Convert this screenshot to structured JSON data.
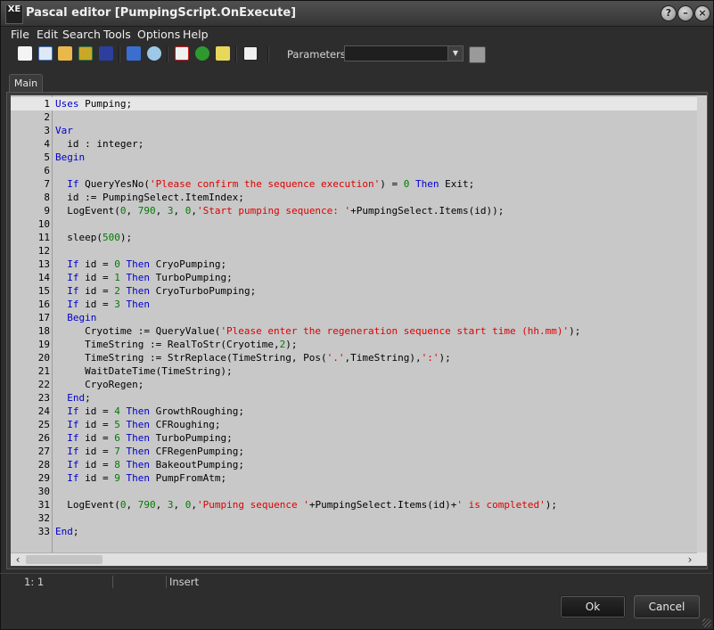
{
  "window": {
    "title": "Pascal editor [PumpingScript.OnExecute]",
    "logo_text": "XE"
  },
  "menu": [
    "File",
    "Edit",
    "Search",
    "Tools",
    "Options",
    "Help"
  ],
  "toolbar": {
    "params_label": "Parameters:",
    "params_value": ""
  },
  "tabs": [
    "Main"
  ],
  "editor": {
    "current_line": 1,
    "lines": [
      [
        {
          "t": "Uses",
          "k": "kw"
        },
        {
          "t": " Pumping;"
        }
      ],
      [],
      [
        {
          "t": "Var",
          "k": "kw"
        }
      ],
      [
        {
          "t": "  id : integer;"
        }
      ],
      [
        {
          "t": "Begin",
          "k": "kw"
        }
      ],
      [],
      [
        {
          "t": "  "
        },
        {
          "t": "If",
          "k": "kw"
        },
        {
          "t": " QueryYesNo("
        },
        {
          "t": "'Please confirm the sequence execution'",
          "k": "str"
        },
        {
          "t": ") = "
        },
        {
          "t": "0",
          "k": "num"
        },
        {
          "t": " "
        },
        {
          "t": "Then",
          "k": "kw"
        },
        {
          "t": " Exit;"
        }
      ],
      [
        {
          "t": "  id := PumpingSelect.ItemIndex;"
        }
      ],
      [
        {
          "t": "  LogEvent("
        },
        {
          "t": "0",
          "k": "num"
        },
        {
          "t": ", "
        },
        {
          "t": "790",
          "k": "num"
        },
        {
          "t": ", "
        },
        {
          "t": "3",
          "k": "num"
        },
        {
          "t": ", "
        },
        {
          "t": "0",
          "k": "num"
        },
        {
          "t": ","
        },
        {
          "t": "'Start pumping sequence: '",
          "k": "str"
        },
        {
          "t": "+PumpingSelect.Items(id));"
        }
      ],
      [],
      [
        {
          "t": "  sleep("
        },
        {
          "t": "500",
          "k": "num"
        },
        {
          "t": ");"
        }
      ],
      [],
      [
        {
          "t": "  "
        },
        {
          "t": "If",
          "k": "kw"
        },
        {
          "t": " id = "
        },
        {
          "t": "0",
          "k": "num"
        },
        {
          "t": " "
        },
        {
          "t": "Then",
          "k": "kw"
        },
        {
          "t": " CryoPumping;"
        }
      ],
      [
        {
          "t": "  "
        },
        {
          "t": "If",
          "k": "kw"
        },
        {
          "t": " id = "
        },
        {
          "t": "1",
          "k": "num"
        },
        {
          "t": " "
        },
        {
          "t": "Then",
          "k": "kw"
        },
        {
          "t": " TurboPumping;"
        }
      ],
      [
        {
          "t": "  "
        },
        {
          "t": "If",
          "k": "kw"
        },
        {
          "t": " id = "
        },
        {
          "t": "2",
          "k": "num"
        },
        {
          "t": " "
        },
        {
          "t": "Then",
          "k": "kw"
        },
        {
          "t": " CryoTurboPumping;"
        }
      ],
      [
        {
          "t": "  "
        },
        {
          "t": "If",
          "k": "kw"
        },
        {
          "t": " id = "
        },
        {
          "t": "3",
          "k": "num"
        },
        {
          "t": " "
        },
        {
          "t": "Then",
          "k": "kw"
        }
      ],
      [
        {
          "t": "  "
        },
        {
          "t": "Begin",
          "k": "kw"
        }
      ],
      [
        {
          "t": "     Cryotime := QueryValue("
        },
        {
          "t": "'Please enter the regeneration sequence start time (hh.mm)'",
          "k": "str"
        },
        {
          "t": ");"
        }
      ],
      [
        {
          "t": "     TimeString := RealToStr(Cryotime,"
        },
        {
          "t": "2",
          "k": "num"
        },
        {
          "t": ");"
        }
      ],
      [
        {
          "t": "     TimeString := StrReplace(TimeString, Pos("
        },
        {
          "t": "'.'",
          "k": "str"
        },
        {
          "t": ",TimeString),"
        },
        {
          "t": "':'",
          "k": "str"
        },
        {
          "t": ");"
        }
      ],
      [
        {
          "t": "     WaitDateTime(TimeString);"
        }
      ],
      [
        {
          "t": "     CryoRegen;"
        }
      ],
      [
        {
          "t": "  "
        },
        {
          "t": "End",
          "k": "kw"
        },
        {
          "t": ";"
        }
      ],
      [
        {
          "t": "  "
        },
        {
          "t": "If",
          "k": "kw"
        },
        {
          "t": " id = "
        },
        {
          "t": "4",
          "k": "num"
        },
        {
          "t": " "
        },
        {
          "t": "Then",
          "k": "kw"
        },
        {
          "t": " GrowthRoughing;"
        }
      ],
      [
        {
          "t": "  "
        },
        {
          "t": "If",
          "k": "kw"
        },
        {
          "t": " id = "
        },
        {
          "t": "5",
          "k": "num"
        },
        {
          "t": " "
        },
        {
          "t": "Then",
          "k": "kw"
        },
        {
          "t": " CFRoughing;"
        }
      ],
      [
        {
          "t": "  "
        },
        {
          "t": "If",
          "k": "kw"
        },
        {
          "t": " id = "
        },
        {
          "t": "6",
          "k": "num"
        },
        {
          "t": " "
        },
        {
          "t": "Then",
          "k": "kw"
        },
        {
          "t": " TurboPumping;"
        }
      ],
      [
        {
          "t": "  "
        },
        {
          "t": "If",
          "k": "kw"
        },
        {
          "t": " id = "
        },
        {
          "t": "7",
          "k": "num"
        },
        {
          "t": " "
        },
        {
          "t": "Then",
          "k": "kw"
        },
        {
          "t": " CFRegenPumping;"
        }
      ],
      [
        {
          "t": "  "
        },
        {
          "t": "If",
          "k": "kw"
        },
        {
          "t": " id = "
        },
        {
          "t": "8",
          "k": "num"
        },
        {
          "t": " "
        },
        {
          "t": "Then",
          "k": "kw"
        },
        {
          "t": " BakeoutPumping;"
        }
      ],
      [
        {
          "t": "  "
        },
        {
          "t": "If",
          "k": "kw"
        },
        {
          "t": " id = "
        },
        {
          "t": "9",
          "k": "num"
        },
        {
          "t": " "
        },
        {
          "t": "Then",
          "k": "kw"
        },
        {
          "t": " PumpFromAtm;"
        }
      ],
      [],
      [
        {
          "t": "  LogEvent("
        },
        {
          "t": "0",
          "k": "num"
        },
        {
          "t": ", "
        },
        {
          "t": "790",
          "k": "num"
        },
        {
          "t": ", "
        },
        {
          "t": "3",
          "k": "num"
        },
        {
          "t": ", "
        },
        {
          "t": "0",
          "k": "num"
        },
        {
          "t": ","
        },
        {
          "t": "'Pumping sequence '",
          "k": "str"
        },
        {
          "t": "+PumpingSelect.Items(id)+"
        },
        {
          "t": "' is completed'",
          "k": "str"
        },
        {
          "t": ");"
        }
      ],
      [],
      [
        {
          "t": "End",
          "k": "kw"
        },
        {
          "t": ";"
        }
      ]
    ]
  },
  "status": {
    "position": "1:  1",
    "mode": "Insert"
  },
  "buttons": {
    "ok": "Ok",
    "cancel": "Cancel"
  },
  "colors": {
    "keyword": "#0000cc",
    "string": "#dd0000",
    "number": "#007c00",
    "editor_bg": "#c8c8c8",
    "current_line": "#e6e6e6"
  }
}
